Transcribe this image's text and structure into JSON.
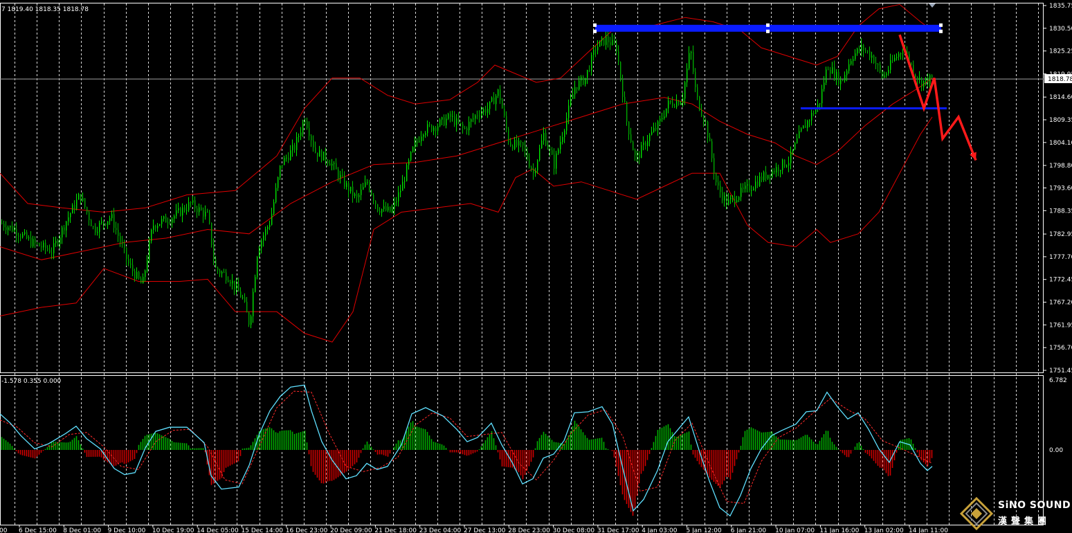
{
  "chart_data": [
    {
      "type": "candlestick",
      "role": "price",
      "ohlc_readout": "7 1819.40 1818.35 1818.78",
      "ylim": [
        1751.45,
        1835.75
      ],
      "y_ticks": [
        1835.75,
        1830.5,
        1825.25,
        1819.95,
        1814.6,
        1809.35,
        1804.1,
        1798.8,
        1793.6,
        1788.35,
        1782.95,
        1777.7,
        1772.45,
        1767.2,
        1761.95,
        1756.7,
        1751.45
      ],
      "current_price": 1818.78,
      "current_price_label": "1818.78",
      "x_ticks": [
        ":00",
        "6 Dec 15:00",
        "8 Dec 01:00",
        "9 Dec 10:00",
        "10 Dec 19:00",
        "14 Dec 05:00",
        "15 Dec 14:00",
        "16 Dec 23:00",
        "20 Dec 09:00",
        "21 Dec 18:00",
        "23 Dec 04:00",
        "27 Dec 13:00",
        "28 Dec 23:00",
        "30 Dec 08:00",
        "31 Dec 17:00",
        "4 Jan 03:00",
        "5 Jan 12:00",
        "6 Jan 21:00",
        "10 Jan 07:00",
        "11 Jan 16:00",
        "13 Jan 02:00",
        "14 Jan 11:00"
      ],
      "close_path": [
        [
          0,
          1785.5
        ],
        [
          20,
          1784
        ],
        [
          45,
          1781
        ],
        [
          75,
          1779
        ],
        [
          95,
          1786
        ],
        [
          115,
          1792
        ],
        [
          135,
          1784
        ],
        [
          160,
          1787
        ],
        [
          185,
          1776
        ],
        [
          205,
          1771
        ],
        [
          220,
          1785
        ],
        [
          250,
          1787
        ],
        [
          275,
          1790
        ],
        [
          300,
          1787
        ],
        [
          310,
          1775
        ],
        [
          330,
          1773
        ],
        [
          350,
          1768
        ],
        [
          360,
          1762
        ],
        [
          372,
          1780
        ],
        [
          390,
          1786
        ],
        [
          405,
          1799
        ],
        [
          425,
          1803
        ],
        [
          440,
          1810
        ],
        [
          455,
          1802
        ],
        [
          475,
          1800
        ],
        [
          495,
          1795
        ],
        [
          515,
          1791
        ],
        [
          530,
          1795
        ],
        [
          545,
          1789
        ],
        [
          565,
          1788
        ],
        [
          580,
          1794
        ],
        [
          595,
          1802
        ],
        [
          610,
          1807
        ],
        [
          630,
          1808
        ],
        [
          650,
          1810
        ],
        [
          670,
          1807
        ],
        [
          690,
          1811
        ],
        [
          705,
          1812
        ],
        [
          720,
          1816
        ],
        [
          735,
          1804
        ],
        [
          755,
          1803
        ],
        [
          770,
          1797
        ],
        [
          785,
          1806
        ],
        [
          800,
          1799
        ],
        [
          815,
          1808
        ],
        [
          830,
          1817
        ],
        [
          845,
          1819
        ],
        [
          860,
          1826
        ],
        [
          875,
          1828
        ],
        [
          890,
          1826
        ],
        [
          905,
          1809
        ],
        [
          918,
          1800
        ],
        [
          935,
          1805
        ],
        [
          950,
          1808
        ],
        [
          965,
          1813
        ],
        [
          985,
          1814
        ],
        [
          997,
          1826
        ],
        [
          1005,
          1815
        ],
        [
          1020,
          1808
        ],
        [
          1035,
          1794
        ],
        [
          1050,
          1790
        ],
        [
          1065,
          1792
        ],
        [
          1085,
          1794
        ],
        [
          1100,
          1796
        ],
        [
          1120,
          1798
        ],
        [
          1140,
          1800
        ],
        [
          1155,
          1806
        ],
        [
          1170,
          1810
        ],
        [
          1183,
          1813
        ],
        [
          1195,
          1822
        ],
        [
          1215,
          1818
        ],
        [
          1230,
          1824
        ],
        [
          1245,
          1826
        ],
        [
          1260,
          1824
        ],
        [
          1275,
          1819
        ],
        [
          1290,
          1823
        ],
        [
          1305,
          1826
        ],
        [
          1318,
          1821
        ],
        [
          1330,
          1818
        ],
        [
          1345,
          1818.78
        ]
      ],
      "bollinger_middle": [
        [
          0,
          1780
        ],
        [
          60,
          1777
        ],
        [
          120,
          1779
        ],
        [
          180,
          1781
        ],
        [
          240,
          1782
        ],
        [
          300,
          1784
        ],
        [
          360,
          1783
        ],
        [
          420,
          1790
        ],
        [
          480,
          1795
        ],
        [
          540,
          1799
        ],
        [
          600,
          1799.5
        ],
        [
          660,
          1801
        ],
        [
          720,
          1804
        ],
        [
          780,
          1807
        ],
        [
          840,
          1810
        ],
        [
          900,
          1813
        ],
        [
          960,
          1814.5
        ],
        [
          1000,
          1813
        ],
        [
          1040,
          1809
        ],
        [
          1080,
          1806
        ],
        [
          1120,
          1804
        ],
        [
          1150,
          1801
        ],
        [
          1180,
          1799
        ],
        [
          1210,
          1802
        ],
        [
          1250,
          1808
        ],
        [
          1290,
          1813
        ],
        [
          1330,
          1817
        ],
        [
          1347,
          1819
        ]
      ],
      "bollinger_upper": [
        [
          0,
          1797
        ],
        [
          40,
          1790
        ],
        [
          90,
          1789
        ],
        [
          150,
          1788
        ],
        [
          210,
          1789
        ],
        [
          270,
          1792
        ],
        [
          340,
          1793
        ],
        [
          400,
          1801
        ],
        [
          440,
          1812
        ],
        [
          480,
          1819
        ],
        [
          520,
          1819
        ],
        [
          560,
          1815
        ],
        [
          600,
          1813
        ],
        [
          650,
          1814
        ],
        [
          690,
          1818
        ],
        [
          715,
          1822
        ],
        [
          745,
          1820
        ],
        [
          775,
          1818
        ],
        [
          810,
          1819
        ],
        [
          850,
          1825
        ],
        [
          885,
          1830
        ],
        [
          940,
          1831
        ],
        [
          990,
          1833
        ],
        [
          1030,
          1832
        ],
        [
          1070,
          1830
        ],
        [
          1100,
          1826
        ],
        [
          1140,
          1824
        ],
        [
          1180,
          1822
        ],
        [
          1210,
          1824
        ],
        [
          1240,
          1831
        ],
        [
          1270,
          1835
        ],
        [
          1300,
          1836
        ],
        [
          1330,
          1832
        ],
        [
          1347,
          1830
        ]
      ],
      "bollinger_lower": [
        [
          0,
          1764
        ],
        [
          60,
          1766
        ],
        [
          110,
          1767
        ],
        [
          150,
          1775
        ],
        [
          200,
          1772
        ],
        [
          260,
          1772
        ],
        [
          300,
          1772.5
        ],
        [
          340,
          1765
        ],
        [
          400,
          1765
        ],
        [
          440,
          1760
        ],
        [
          480,
          1758
        ],
        [
          510,
          1765
        ],
        [
          540,
          1784
        ],
        [
          580,
          1788
        ],
        [
          630,
          1789
        ],
        [
          680,
          1790
        ],
        [
          720,
          1788
        ],
        [
          745,
          1796
        ],
        [
          770,
          1798
        ],
        [
          800,
          1794
        ],
        [
          840,
          1795
        ],
        [
          880,
          1793
        ],
        [
          920,
          1791
        ],
        [
          960,
          1794
        ],
        [
          1000,
          1797
        ],
        [
          1040,
          1797
        ],
        [
          1080,
          1785
        ],
        [
          1110,
          1781
        ],
        [
          1150,
          1780
        ],
        [
          1180,
          1784
        ],
        [
          1200,
          1781
        ],
        [
          1240,
          1783
        ],
        [
          1270,
          1788
        ],
        [
          1300,
          1797
        ],
        [
          1330,
          1806
        ],
        [
          1347,
          1810
        ]
      ],
      "annotations": {
        "resistance_level": 1830.5,
        "support_level": 1812.0,
        "forecast_path": [
          [
            1300,
            1829
          ],
          [
            1335,
            1812
          ],
          [
            1350,
            1819
          ],
          [
            1362,
            1805
          ],
          [
            1385,
            1810
          ],
          [
            1410,
            1800
          ]
        ]
      },
      "colors": {
        "bull": "#00e600",
        "bear": "#ff3030",
        "bands": "#e00000",
        "levels": "#0a1cff",
        "forecast": "#ff1a1a",
        "grid": "#ffffff",
        "axis_text": "#ffffff"
      }
    },
    {
      "type": "histogram",
      "role": "macd",
      "readout": "-1.578 0.355 0.000",
      "ylim": [
        -6.9,
        6.782
      ],
      "y_ticks": [
        6.782,
        0.0
      ],
      "y_tick_labels": [
        "6.782",
        "0.00"
      ],
      "main_line": [
        [
          0,
          3.5
        ],
        [
          15,
          2.6
        ],
        [
          30,
          1.4
        ],
        [
          50,
          0.1
        ],
        [
          70,
          0.6
        ],
        [
          95,
          1.6
        ],
        [
          110,
          2.3
        ],
        [
          125,
          1.1
        ],
        [
          145,
          0.1
        ],
        [
          165,
          -1.8
        ],
        [
          180,
          -2.4
        ],
        [
          195,
          -2.2
        ],
        [
          210,
          0.2
        ],
        [
          225,
          1.8
        ],
        [
          245,
          2.2
        ],
        [
          270,
          2.2
        ],
        [
          295,
          0.7
        ],
        [
          305,
          -2.5
        ],
        [
          320,
          -3.8
        ],
        [
          345,
          -3.6
        ],
        [
          360,
          -1.5
        ],
        [
          375,
          1.6
        ],
        [
          390,
          3.8
        ],
        [
          405,
          5.2
        ],
        [
          420,
          6.1
        ],
        [
          440,
          6.3
        ],
        [
          450,
          3.8
        ],
        [
          465,
          0.8
        ],
        [
          480,
          -1.0
        ],
        [
          500,
          -2.8
        ],
        [
          515,
          -2.5
        ],
        [
          530,
          -1.3
        ],
        [
          545,
          -1.9
        ],
        [
          560,
          -1.6
        ],
        [
          580,
          0.5
        ],
        [
          595,
          3.5
        ],
        [
          615,
          4.1
        ],
        [
          640,
          3.3
        ],
        [
          660,
          2.0
        ],
        [
          675,
          0.8
        ],
        [
          690,
          1.2
        ],
        [
          710,
          2.6
        ],
        [
          725,
          0.5
        ],
        [
          740,
          -1.2
        ],
        [
          755,
          -3.3
        ],
        [
          770,
          -2.8
        ],
        [
          785,
          -0.8
        ],
        [
          800,
          -0.4
        ],
        [
          815,
          0.9
        ],
        [
          830,
          3.6
        ],
        [
          850,
          3.7
        ],
        [
          870,
          4.2
        ],
        [
          885,
          2.5
        ],
        [
          900,
          -1.8
        ],
        [
          915,
          -5.9
        ],
        [
          930,
          -4.8
        ],
        [
          950,
          -2.0
        ],
        [
          965,
          0.8
        ],
        [
          980,
          2.0
        ],
        [
          995,
          3.2
        ],
        [
          1010,
          0.0
        ],
        [
          1025,
          -3.0
        ],
        [
          1040,
          -5.6
        ],
        [
          1055,
          -6.4
        ],
        [
          1070,
          -4.4
        ],
        [
          1085,
          -1.8
        ],
        [
          1100,
          0.1
        ],
        [
          1115,
          1.4
        ],
        [
          1130,
          1.9
        ],
        [
          1150,
          2.5
        ],
        [
          1165,
          3.7
        ],
        [
          1180,
          3.8
        ],
        [
          1195,
          5.6
        ],
        [
          1210,
          4.2
        ],
        [
          1225,
          3.0
        ],
        [
          1240,
          3.6
        ],
        [
          1255,
          2.0
        ],
        [
          1270,
          0.1
        ],
        [
          1285,
          -1.2
        ],
        [
          1300,
          0.8
        ],
        [
          1315,
          0.5
        ],
        [
          1330,
          -1.3
        ],
        [
          1340,
          -2.0
        ],
        [
          1347,
          -1.6
        ]
      ],
      "signal_line": [
        [
          0,
          2.9
        ],
        [
          25,
          2.2
        ],
        [
          50,
          0.7
        ],
        [
          75,
          0.3
        ],
        [
          100,
          1.5
        ],
        [
          125,
          1.7
        ],
        [
          150,
          0.3
        ],
        [
          175,
          -1.6
        ],
        [
          200,
          -1.9
        ],
        [
          225,
          0.8
        ],
        [
          250,
          1.9
        ],
        [
          275,
          2.0
        ],
        [
          300,
          0.3
        ],
        [
          325,
          -2.9
        ],
        [
          350,
          -3.3
        ],
        [
          375,
          0.4
        ],
        [
          400,
          4.1
        ],
        [
          425,
          5.7
        ],
        [
          450,
          5.6
        ],
        [
          475,
          1.7
        ],
        [
          500,
          -1.6
        ],
        [
          525,
          -2.1
        ],
        [
          550,
          -1.7
        ],
        [
          575,
          -0.7
        ],
        [
          600,
          2.4
        ],
        [
          625,
          3.6
        ],
        [
          650,
          3.1
        ],
        [
          675,
          1.3
        ],
        [
          700,
          1.5
        ],
        [
          725,
          1.7
        ],
        [
          750,
          -1.3
        ],
        [
          775,
          -2.9
        ],
        [
          800,
          -1.0
        ],
        [
          825,
          1.6
        ],
        [
          850,
          3.4
        ],
        [
          875,
          3.9
        ],
        [
          900,
          1.3
        ],
        [
          925,
          -4.0
        ],
        [
          950,
          -3.6
        ],
        [
          975,
          0.9
        ],
        [
          1000,
          2.6
        ],
        [
          1025,
          -1.4
        ],
        [
          1050,
          -5.0
        ],
        [
          1075,
          -5.2
        ],
        [
          1100,
          -1.1
        ],
        [
          1125,
          1.2
        ],
        [
          1150,
          2.1
        ],
        [
          1175,
          3.6
        ],
        [
          1200,
          5.0
        ],
        [
          1225,
          3.9
        ],
        [
          1250,
          3.0
        ],
        [
          1275,
          0.9
        ],
        [
          1300,
          0.2
        ],
        [
          1325,
          -0.6
        ],
        [
          1347,
          -1.3
        ]
      ],
      "colors": {
        "main_line": "#5fe0ff",
        "signal_line": "#ff2a2a",
        "hist_positive": "#00b000",
        "hist_negative": "#d00000"
      }
    }
  ],
  "branding": {
    "name": "SiNO SOUND",
    "subtitle": "漢聲集團"
  }
}
